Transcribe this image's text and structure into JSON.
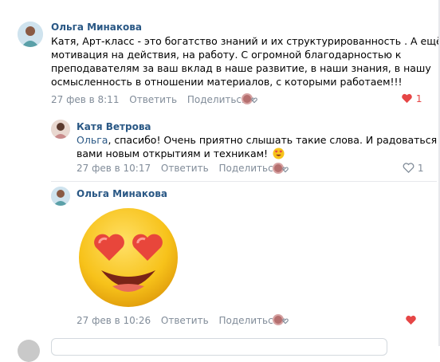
{
  "comments": [
    {
      "author": "Ольга Минакова",
      "lines": [
        "Катя, Арт-класс - это богатство знаний и их структурированность . А ещё",
        "мотивация на действия, на работу. С огромной благодарностью к",
        "преподавателям за ваш вклад в наше развитие, в наши знания, в нашу",
        "осмысленность в отношении материалов, с которыми работаем!!!"
      ],
      "date": "27 фев в 8:11",
      "reply_label": "Ответить",
      "share_label": "Поделиться",
      "likes": "1"
    },
    {
      "author": "Катя Ветрова",
      "mention": "Ольга",
      "line1_rest": ", спасибо! Очень приятно слышать такие слова. И радоваться с",
      "line2": "вами новым открытиям и техникам!",
      "date": "27 фев в 10:17",
      "reply_label": "Ответить",
      "share_label": "Поделиться",
      "likes": "1"
    },
    {
      "author": "Ольга Минакова",
      "sticker": "heart-eyes-smiley",
      "date": "27 фев в 10:26",
      "reply_label": "Ответить",
      "share_label": "Поделиться"
    }
  ],
  "colors": {
    "link": "#2a5885",
    "meta": "#818c99",
    "heart": "#e64646",
    "sticker_face": "#f7c21a"
  },
  "icons": [
    "heart-icon",
    "heart-outline-icon",
    "reaction-icon",
    "heart-eyes-emoji-icon"
  ]
}
